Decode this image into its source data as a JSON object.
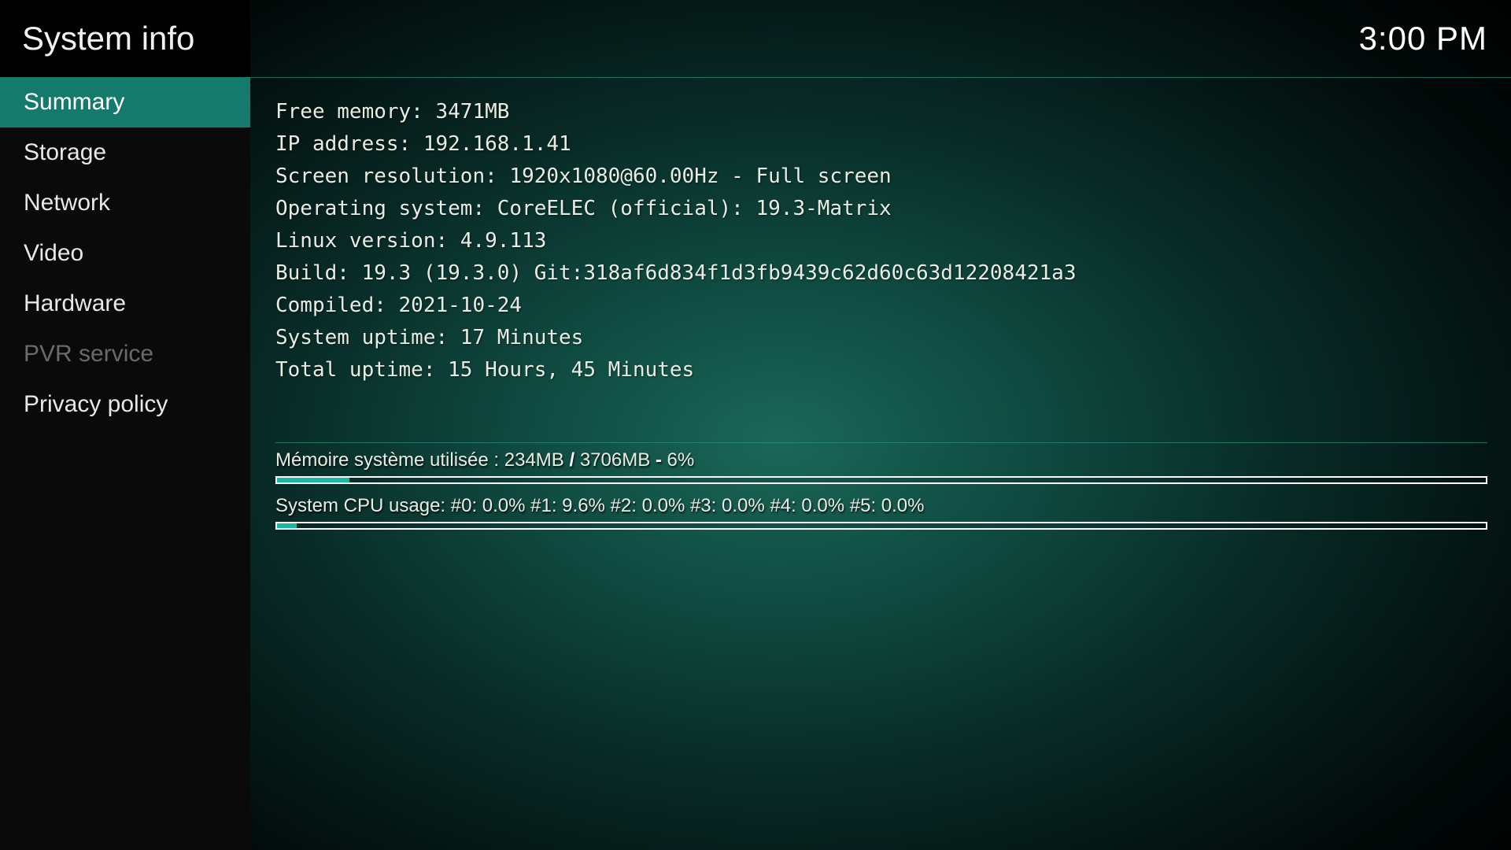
{
  "header": {
    "title": "System info",
    "clock": "3:00 PM"
  },
  "sidebar": {
    "items": [
      {
        "label": "Summary",
        "active": true,
        "disabled": false
      },
      {
        "label": "Storage",
        "active": false,
        "disabled": false
      },
      {
        "label": "Network",
        "active": false,
        "disabled": false
      },
      {
        "label": "Video",
        "active": false,
        "disabled": false
      },
      {
        "label": "Hardware",
        "active": false,
        "disabled": false
      },
      {
        "label": "PVR service",
        "active": false,
        "disabled": true
      },
      {
        "label": "Privacy policy",
        "active": false,
        "disabled": false
      }
    ]
  },
  "summary": {
    "lines": [
      "Free memory: 3471MB",
      "IP address: 192.168.1.41",
      "Screen resolution: 1920x1080@60.00Hz - Full screen",
      "Operating system: CoreELEC (official): 19.3-Matrix",
      "Linux version: 4.9.113",
      "Build: 19.3 (19.3.0) Git:318af6d834f1d3fb9439c62d60c63d12208421a3",
      "Compiled: 2021-10-24",
      "System uptime: 17 Minutes",
      "Total uptime: 15 Hours, 45 Minutes"
    ]
  },
  "footer": {
    "memory": {
      "label_prefix": "Mémoire système utilisée : ",
      "used": "234MB",
      "sep1": " / ",
      "total": "3706MB",
      "sep2": " - ",
      "percent_label": "6%",
      "percent_value": 6
    },
    "cpu": {
      "label": "System CPU usage: #0: 0.0% #1: 9.6% #2: 0.0% #3: 0.0% #4: 0.0% #5: 0.0%",
      "percent_value": 1.6
    }
  },
  "colors": {
    "accent": "#147a6c",
    "progress_fill": "#19b89f"
  }
}
